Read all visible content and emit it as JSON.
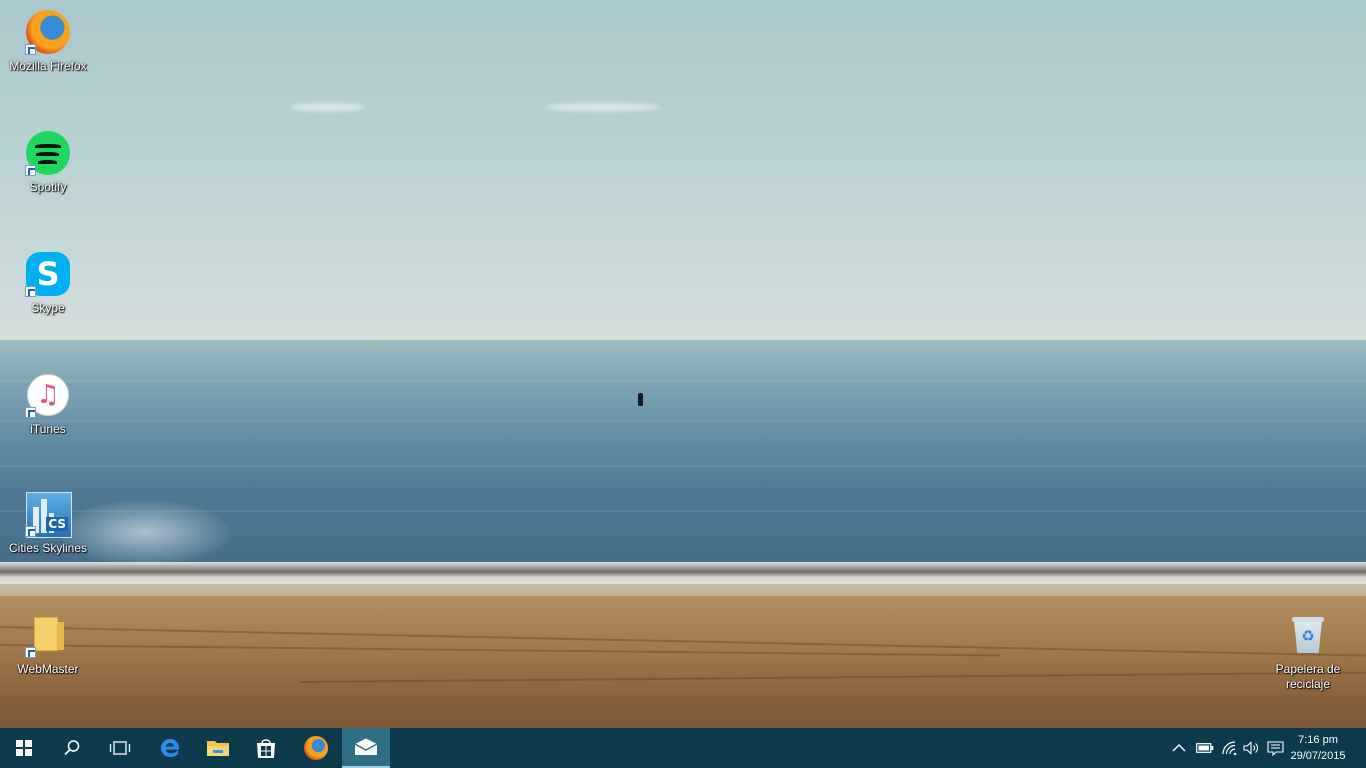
{
  "desktop": {
    "icons": [
      {
        "label": "Mozilla Firefox",
        "icon": "firefox-icon"
      },
      {
        "label": "Spotify",
        "icon": "spotify-icon"
      },
      {
        "label": "Skype",
        "icon": "skype-icon"
      },
      {
        "label": "iTunes",
        "icon": "itunes-icon"
      },
      {
        "label": "Cities Skylines",
        "icon": "cities-skylines-icon"
      },
      {
        "label": "WebMaster",
        "icon": "folder-icon"
      }
    ],
    "recycle_bin": {
      "label": "Papelera de reciclaje",
      "icon": "recycle-bin-icon"
    },
    "glyphs": {
      "skype_letter": "S",
      "itunes_note": "♫",
      "cities_badge": "CS",
      "recycle_symbol": "♻"
    }
  },
  "taskbar": {
    "background_color": "#0d3b4c",
    "buttons": [
      "start-icon",
      "search-icon",
      "task-view-icon",
      "edge-icon",
      "file-explorer-icon",
      "store-icon",
      "firefox-icon",
      "mail-icon"
    ],
    "active_button": "mail-icon",
    "tray": [
      "chevron-up-icon",
      "battery-icon",
      "wifi-icon",
      "volume-icon",
      "action-center-icon"
    ],
    "clock": {
      "time": "7:16 pm",
      "date": "29/07/2015"
    }
  }
}
